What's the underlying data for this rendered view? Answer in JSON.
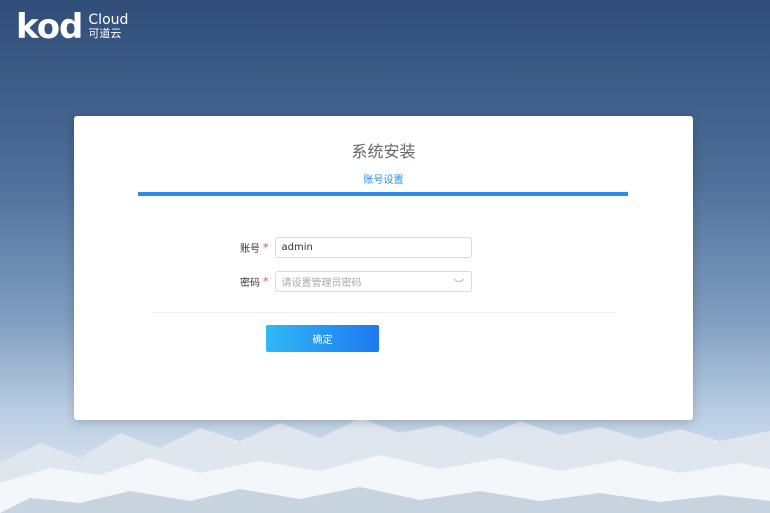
{
  "logo": {
    "mark": "kod",
    "en": "Cloud",
    "cn": "可道云"
  },
  "dialog": {
    "title": "系统安装",
    "step_label": "账号设置",
    "account": {
      "label": "账号",
      "required_mark": "*",
      "value": "admin"
    },
    "password": {
      "label": "密码",
      "required_mark": "*",
      "placeholder": "请设置管理员密码"
    },
    "submit_label": "确定"
  }
}
